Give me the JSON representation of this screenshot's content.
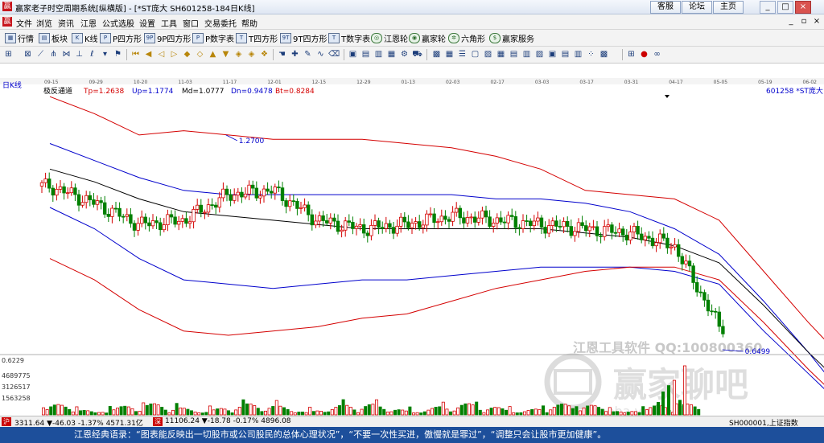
{
  "window": {
    "title": "赢家老子时空周期系统[纵横版] - [*ST庞大  SH601258-184日K线]",
    "buttons": {
      "kefu": "客服",
      "luntan": "论坛",
      "zhuye": "主页"
    }
  },
  "menu": [
    "文件",
    "浏览",
    "资讯",
    "江恩",
    "公式选股",
    "设置",
    "工具",
    "窗口",
    "交易委托",
    "帮助"
  ],
  "toolbar1": [
    {
      "label": "行情",
      "icon": "grid-icon"
    },
    {
      "label": "板块",
      "icon": "blocks-icon"
    },
    {
      "label": "K线",
      "icon": "candle-icon"
    },
    {
      "label": "P四方形",
      "icon": "p-square-icon"
    },
    {
      "label": "9P四方形",
      "icon": "9p-square-icon"
    },
    {
      "label": "P数字表",
      "icon": "p-table-icon"
    },
    {
      "label": "T四方形",
      "icon": "t-square-icon"
    },
    {
      "label": "9T四方形",
      "icon": "9t-square-icon"
    },
    {
      "label": "T数字表",
      "icon": "t-table-icon"
    },
    {
      "label": "江恩轮",
      "icon": "gann-wheel-icon"
    },
    {
      "label": "赢家轮",
      "icon": "winner-wheel-icon"
    },
    {
      "label": "六角形",
      "icon": "hexagon-icon"
    },
    {
      "label": "赢家服务",
      "icon": "dollar-icon"
    }
  ],
  "chart": {
    "period_label": "日K线",
    "indicator_name": "极反通道",
    "indicator_values": [
      {
        "text": "Tp=1.2638",
        "color": "#d40000"
      },
      {
        "text": "Up=1.1774",
        "color": "#0000cc"
      },
      {
        "text": "Md=1.0777",
        "color": "#000000"
      },
      {
        "text": "Dn=0.9478",
        "color": "#0000cc"
      },
      {
        "text": "Bt=0.8284",
        "color": "#d40000"
      }
    ],
    "stock_label": "601258 *ST庞大",
    "date_ticks": [
      "09-15",
      "09-29",
      "10-20",
      "11-03",
      "11-17",
      "12-01",
      "12-15",
      "12-29",
      "01-13",
      "02-03",
      "02-17",
      "03-03",
      "03-17",
      "03-31",
      "04-17",
      "05-05",
      "05-19",
      "06-02",
      "06-16"
    ],
    "high_label": "1.2700",
    "low_label": "0.6499",
    "volume_axis": [
      "0.6229",
      "4689775",
      "3126517",
      "1563258"
    ],
    "watermark": {
      "line1": "江恩工具软件  QQ:100800360",
      "logo": "赢家聊吧",
      "url": "liaoba.vip"
    },
    "colors": {
      "top_band": "#d40000",
      "upper_band": "#0000cc",
      "middle": "#000000",
      "up_candle": "#d40000",
      "down_candle": "#008000"
    }
  },
  "chart_data": {
    "type": "line",
    "title": "*ST庞大 SH601258 日K线",
    "x": [
      "09-15",
      "09-29",
      "10-20",
      "11-03",
      "11-17",
      "12-01",
      "12-15",
      "12-29",
      "01-13",
      "02-03",
      "02-17",
      "03-03",
      "03-17",
      "03-31",
      "04-17",
      "05-05",
      "05-19",
      "06-02",
      "06-16"
    ],
    "series": [
      {
        "name": "Tp",
        "values": [
          1.36,
          1.32,
          1.27,
          1.28,
          1.27,
          1.26,
          1.26,
          1.26,
          1.25,
          1.24,
          1.22,
          1.19,
          1.14,
          1.13,
          1.12,
          1.07,
          0.95,
          0.83,
          0.72
        ]
      },
      {
        "name": "Up",
        "values": [
          1.25,
          1.21,
          1.17,
          1.14,
          1.13,
          1.13,
          1.13,
          1.13,
          1.13,
          1.13,
          1.12,
          1.12,
          1.11,
          1.09,
          1.05,
          0.99,
          0.88,
          0.76,
          0.63
        ]
      },
      {
        "name": "Md",
        "values": [
          1.19,
          1.16,
          1.12,
          1.09,
          1.08,
          1.07,
          1.06,
          1.05,
          1.05,
          1.05,
          1.05,
          1.05,
          1.04,
          1.03,
          1.01,
          0.97,
          0.87,
          0.76,
          0.66
        ]
      },
      {
        "name": "Dn",
        "values": [
          1.1,
          1.05,
          0.98,
          0.93,
          0.92,
          0.91,
          0.92,
          0.93,
          0.93,
          0.94,
          0.95,
          0.96,
          0.96,
          0.96,
          0.95,
          0.92,
          0.81,
          0.71,
          0.61
        ]
      },
      {
        "name": "Bt",
        "values": [
          0.98,
          0.93,
          0.86,
          0.81,
          0.8,
          0.81,
          0.82,
          0.84,
          0.85,
          0.88,
          0.91,
          0.93,
          0.95,
          0.96,
          0.96,
          0.93,
          0.83,
          0.72,
          0.62
        ]
      },
      {
        "name": "Close",
        "values": [
          1.15,
          1.11,
          1.06,
          1.07,
          1.13,
          1.14,
          1.07,
          1.05,
          1.06,
          1.08,
          1.07,
          1.06,
          1.05,
          1.04,
          1.01,
          0.82,
          null,
          null,
          null
        ]
      }
    ],
    "annotations": [
      "1.2700",
      "0.6499"
    ],
    "volume_ticks": [
      4689775,
      3126517,
      1563258
    ]
  },
  "statusbar": {
    "sh_index": "3311.64 ▼-46.03 -1.37% 4571.31亿",
    "sz_index": "11106.24 ▼-18.78 -0.17% 4896.08",
    "right_label": "SH000001,上证指数"
  },
  "quote": "江恩经典语录：“图表能反映出一切股市或公司股民的总体心理状况”，“不要一次性买进，傲慢就是罪过”，“调整只会让股市更加健康”。"
}
